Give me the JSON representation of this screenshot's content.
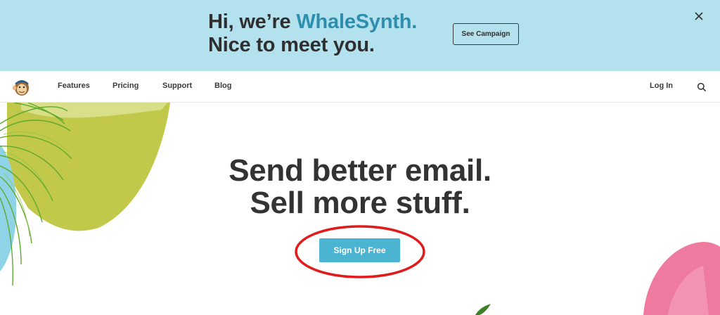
{
  "banner": {
    "greeting": "Hi, we’re ",
    "brand": "WhaleSynth.",
    "line2": "Nice to meet you.",
    "cta_label": "See Campaign",
    "close_icon": "close-icon"
  },
  "nav": {
    "logo_icon": "monkey-logo-icon",
    "items": [
      {
        "label": "Features"
      },
      {
        "label": "Pricing"
      },
      {
        "label": "Support"
      },
      {
        "label": "Blog"
      }
    ],
    "login_label": "Log In",
    "search_icon": "search-icon"
  },
  "hero": {
    "line1": "Send better email.",
    "line2": "Sell more stuff.",
    "cta_label": "Sign Up Free"
  },
  "colors": {
    "banner_bg": "#b4e1ee",
    "brand_accent": "#2d8fad",
    "cta_bg": "#4bb4d1",
    "annotation_red": "#e01b1b",
    "yellow_shape": "#c2c94a",
    "pink_shape": "#ef7a9f",
    "palm_green": "#5fa92c"
  }
}
